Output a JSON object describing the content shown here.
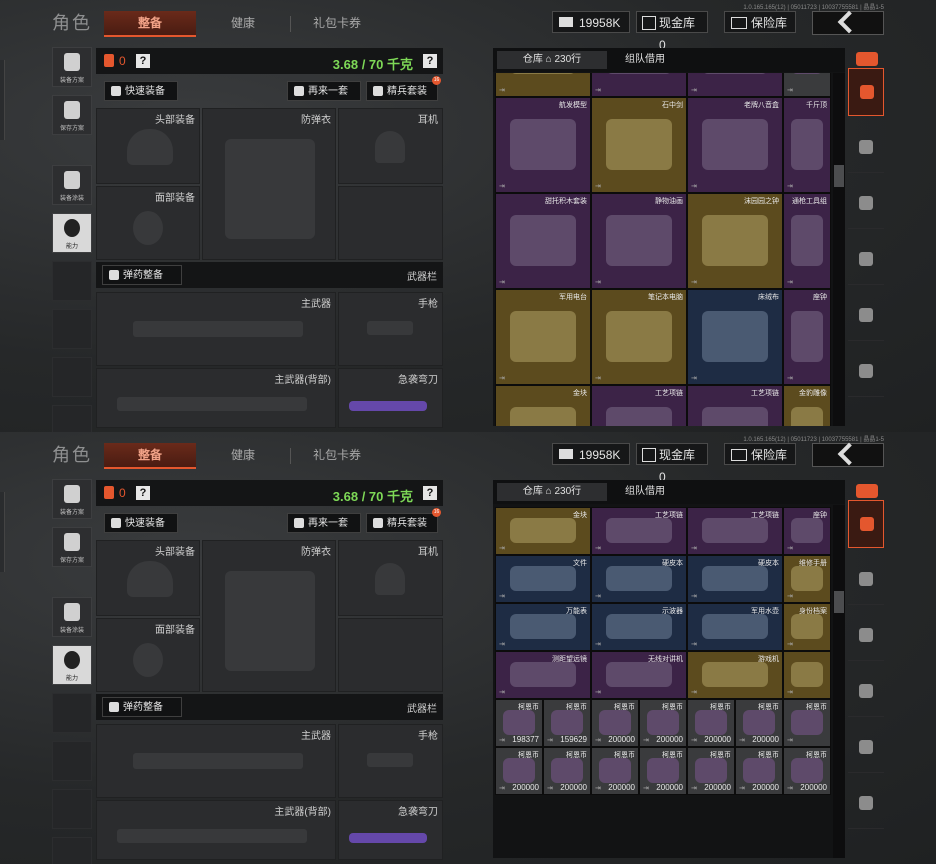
{
  "header": {
    "title": "角色",
    "tabs": [
      {
        "label": "整备",
        "active": true
      },
      {
        "label": "健康"
      },
      {
        "label": "礼包卡券"
      }
    ],
    "version": "1.0.165.165(12) | 05011723 | 10037755581 | 晶晶1-5",
    "currency_value": "19958K",
    "cash_vault_label": "现金库 0",
    "safe_label": "保险库",
    "back_icon": "chevron-left-icon"
  },
  "sidebar": {
    "items": [
      {
        "label": "装备方案",
        "icon": "vest-icon"
      },
      {
        "label": "保存方案",
        "icon": "download-icon"
      },
      {
        "label": "装备涂装",
        "icon": "helmet-paint-icon"
      },
      {
        "label": "能力",
        "icon": "bolt-gear-icon",
        "active": true
      }
    ]
  },
  "loadout": {
    "weight_count": "0",
    "help": "?",
    "weight": "3.68 / 70 千克",
    "quick_equip": "快速装备",
    "again": "再来一套",
    "elite": "精兵套装",
    "elite_badge": "16",
    "slots": {
      "head": "头部装备",
      "armor": "防弹衣",
      "ear": "耳机",
      "face": "面部装备",
      "primary": "主武器",
      "pistol": "手枪",
      "primary_back": "主武器(背部)",
      "knife": "急袭弯刀"
    },
    "ammo_button": "弹药整备",
    "weapon_bar": "武器栏"
  },
  "storage": {
    "tabs": [
      {
        "label": "仓库 ⌂ 230行",
        "active": true
      },
      {
        "label": "组队借用"
      }
    ],
    "top_view": [
      {
        "label": "",
        "color": "c-yellow"
      },
      {
        "label": "",
        "color": "c-purple"
      },
      {
        "label": "",
        "color": "c-purple"
      },
      {
        "label": "",
        "color": "c-gray"
      },
      {
        "label": "航发模型",
        "color": "c-purple"
      },
      {
        "label": "石中剑",
        "color": "c-yellow"
      },
      {
        "label": "老牌八音盒",
        "color": "c-purple"
      },
      {
        "label": "千斤顶",
        "color": "c-purple"
      },
      {
        "label": "甜托积木套装",
        "color": "c-purple"
      },
      {
        "label": "静物油画",
        "color": "c-purple"
      },
      {
        "label": "沫园园之钟",
        "color": "c-yellow"
      },
      {
        "label": "通枪工具组",
        "color": "c-purple"
      },
      {
        "label": "军用电台",
        "color": "c-yellow"
      },
      {
        "label": "笔记本电脑",
        "color": "c-yellow"
      },
      {
        "label": "床绒布",
        "color": "c-blue"
      },
      {
        "label": "座钟",
        "color": "c-purple"
      },
      {
        "label": "金块",
        "color": "c-yellow"
      },
      {
        "label": "工艺项链",
        "color": "c-purple"
      },
      {
        "label": "工艺项链",
        "color": "c-purple"
      },
      {
        "label": "金豹雕像",
        "color": "c-yellow"
      }
    ],
    "bottom_view": [
      {
        "label": "金块",
        "color": "c-yellow"
      },
      {
        "label": "工艺项链",
        "color": "c-purple"
      },
      {
        "label": "工艺项链",
        "color": "c-purple"
      },
      {
        "label": "座钟",
        "color": "c-purple"
      },
      {
        "label": "文件",
        "color": "c-blue"
      },
      {
        "label": "硬皮本",
        "color": "c-blue"
      },
      {
        "label": "硬皮本",
        "color": "c-blue"
      },
      {
        "label": "维修手册",
        "color": "c-yellow"
      },
      {
        "label": "万能表",
        "color": "c-blue"
      },
      {
        "label": "示波器",
        "color": "c-blue"
      },
      {
        "label": "军用水壶",
        "color": "c-blue"
      },
      {
        "label": "身份档案",
        "color": "c-yellow"
      },
      {
        "label": "测距望远镜",
        "color": "c-purple"
      },
      {
        "label": "无线对讲机",
        "color": "c-purple"
      },
      {
        "label": "游戏机",
        "color": "c-yellow"
      },
      {
        "label": "",
        "color": "c-yellow"
      }
    ],
    "coins_label": "柯恩币",
    "coins_row1": [
      "198377",
      "159629",
      "200000",
      "200000",
      "200000",
      "200000",
      ""
    ],
    "coins_row2": [
      "200000",
      "200000",
      "200000",
      "200000",
      "200000",
      "200000",
      "200000"
    ]
  },
  "right_categories": [
    "all-icon",
    "helmet-icon",
    "rifle-icon",
    "magazine-icon",
    "bottle-icon",
    "armor-icon"
  ]
}
